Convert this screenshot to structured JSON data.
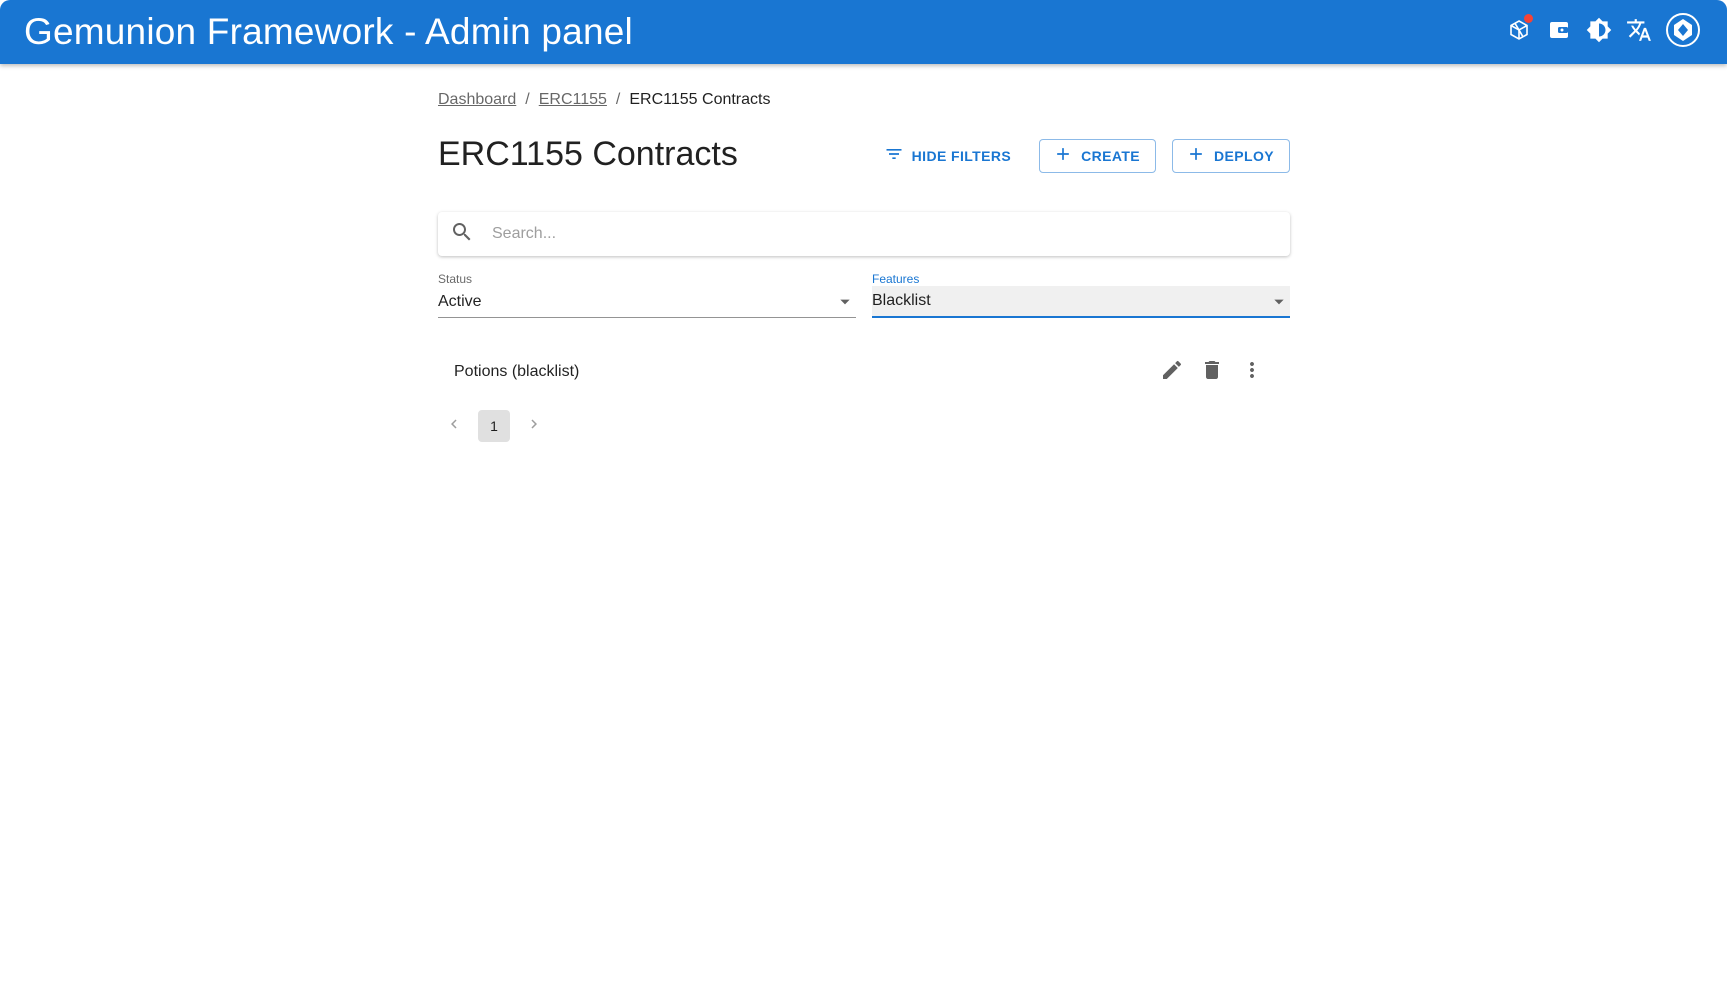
{
  "app": {
    "title": "Gemunion Framework - Admin panel",
    "header_icons": [
      "network-icon",
      "wallet-icon",
      "theme-toggle-icon",
      "translate-icon",
      "account-icon"
    ],
    "accent": "#1976d2",
    "notification_dot_color": "#f44336"
  },
  "breadcrumb": {
    "items": [
      "Dashboard",
      "ERC1155"
    ],
    "current": "ERC1155 Contracts",
    "separator": "/"
  },
  "page": {
    "title": "ERC1155 Contracts"
  },
  "actions": {
    "hide_filters": "HIDE FILTERS",
    "create": "CREATE",
    "deploy": "DEPLOY"
  },
  "search": {
    "placeholder": "Search...",
    "value": ""
  },
  "filters": {
    "status": {
      "label": "Status",
      "value": "Active"
    },
    "features": {
      "label": "Features",
      "value": "Blacklist"
    }
  },
  "list": {
    "items": [
      {
        "name": "Potions (blacklist)"
      }
    ]
  },
  "pagination": {
    "current_page": "1"
  }
}
